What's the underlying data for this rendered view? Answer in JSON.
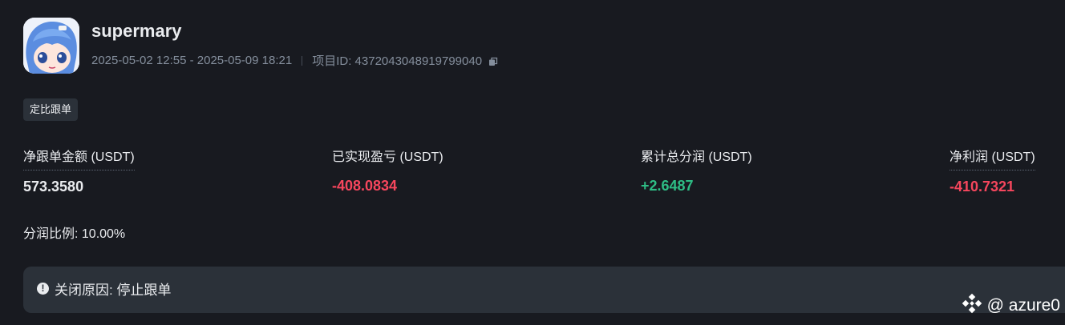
{
  "header": {
    "username": "supermary",
    "period": "2025-05-02 12:55 - 2025-05-09 18:21",
    "project_id": "项目ID: 4372043048919799040"
  },
  "tag": "定比跟单",
  "stats": [
    {
      "label": "净跟单金额 (USDT)",
      "value": "573.3580",
      "color": "neutral"
    },
    {
      "label": "已实现盈亏 (USDT)",
      "value": "-408.0834",
      "color": "negative"
    },
    {
      "label": "累计总分润 (USDT)",
      "value": "+2.6487",
      "color": "positive"
    },
    {
      "label": "净利润 (USDT)",
      "value": "-410.7321",
      "color": "negative"
    }
  ],
  "share_ratio": "分润比例: 10.00%",
  "close_reason": "关闭原因: 停止跟单",
  "watermark": "@ azure0",
  "colors": {
    "background": "#181a20",
    "panel": "#2b3139",
    "text": "#eaecef",
    "muted": "#848e9c",
    "negative": "#f6465d",
    "positive": "#2ebd85"
  },
  "icons": {
    "copy": "copy-icon",
    "info": "info-icon",
    "watermark_logo": "binance-logo-icon"
  }
}
